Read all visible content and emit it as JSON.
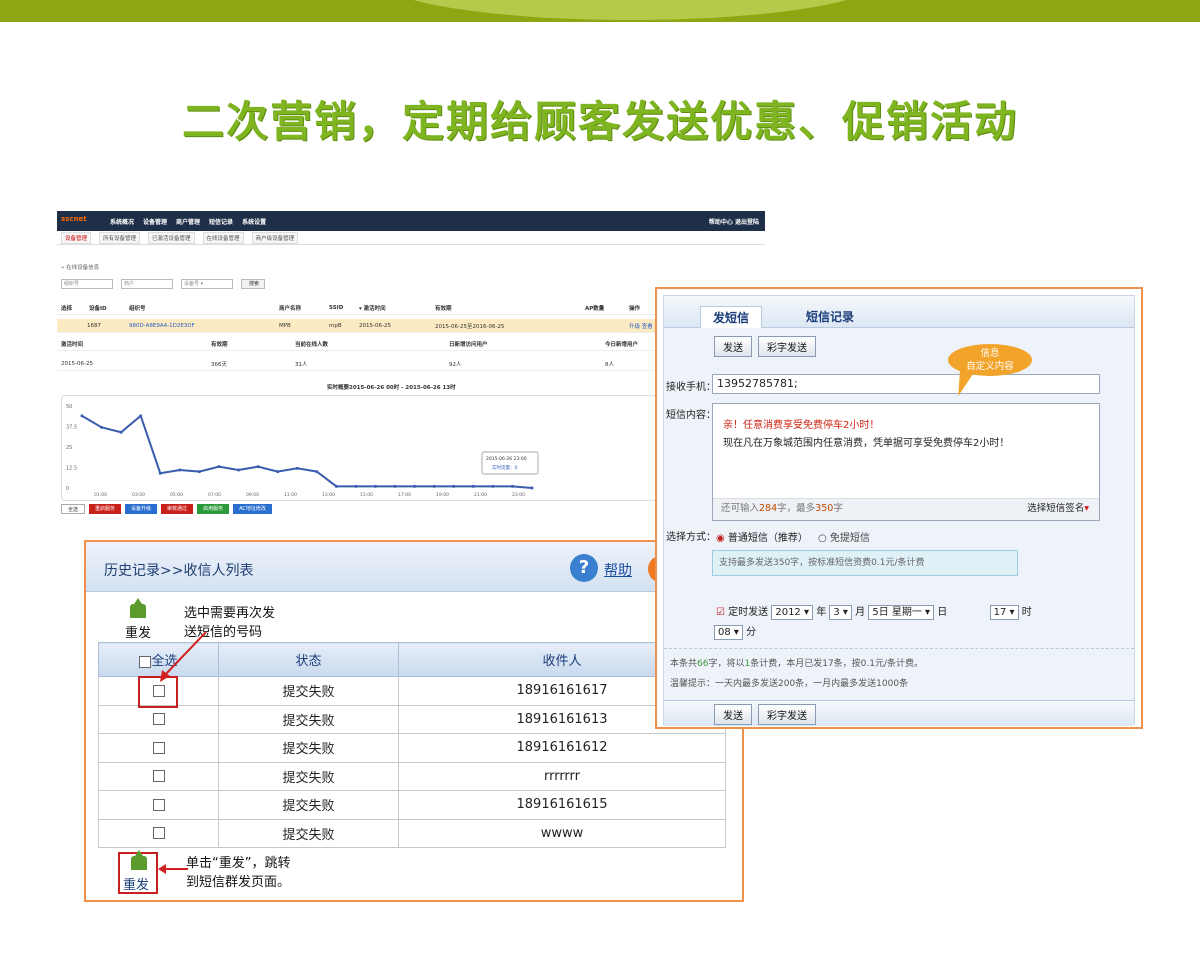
{
  "headline": "二次营销，定期给顾客发送优惠、促销活动",
  "admin": {
    "logo": "sscnet",
    "nav": [
      "系统概况",
      "设备管理",
      "商户管理",
      "短信记录",
      "系统设置"
    ],
    "nav_right": "帮助中心 退出登陆",
    "subnav": [
      "设备管理",
      "所有设备管理",
      "已激活设备管理",
      "在线设备管理",
      "商户级设备管理"
    ],
    "crumb": "» 在线设备信息",
    "filters": [
      "组织号",
      "商户",
      "设备号 ▾",
      "搜索"
    ],
    "header_row": [
      "选择",
      "设备ID",
      "组织号",
      "商户名称",
      "SSID",
      "▾ 激活时间",
      "有效期",
      "AP数量",
      "操作"
    ],
    "device_row": [
      "1687",
      "980D-A8E9A4-1D2E3DF",
      "MPB",
      "mpB",
      "2015-06-25",
      "2015-06-25至2016-06-25",
      "升级 查看"
    ],
    "stats_header": [
      "激活时间",
      "有效期",
      "当前在线人数",
      "日新增访问用户",
      "今日新增用户"
    ],
    "stats_row": [
      "2015-06-25",
      "366天",
      "31人",
      "92人",
      "8人"
    ],
    "chart_title": "实时概要2015-06-26 00时 - 2015-06-26 13时",
    "chart_y_ticks": [
      "50",
      "37.5",
      "25",
      "12.5",
      "0"
    ],
    "chart_x_ticks": [
      "01:00",
      "03:00",
      "05:00",
      "07:00",
      "09:00",
      "11:00",
      "13:00",
      "15:00",
      "17:00",
      "19:00",
      "21:00",
      "23:00"
    ],
    "tooltip": [
      "2015-06-26 23:00",
      "实时流量：0"
    ],
    "legend_buttons": [
      "全选",
      "重启服务",
      "设备升级",
      "审核通过",
      "启用服务",
      "AC地址修改"
    ]
  },
  "chart_data": {
    "type": "line",
    "title": "实时概要2015-06-26 00时 - 2015-06-26 13时",
    "x": [
      "00:00",
      "01:00",
      "02:00",
      "03:00",
      "04:00",
      "05:00",
      "06:00",
      "07:00",
      "08:00",
      "09:00",
      "10:00",
      "11:00",
      "12:00",
      "13:00",
      "14:00",
      "15:00",
      "16:00",
      "17:00",
      "18:00",
      "19:00",
      "20:00",
      "21:00",
      "22:00",
      "23:00"
    ],
    "values": [
      44,
      37,
      34,
      44,
      9,
      11,
      10,
      13,
      11,
      13,
      10,
      12,
      10,
      1,
      1,
      1,
      1,
      1,
      1,
      1,
      1,
      1,
      1,
      0
    ],
    "ylim": [
      0,
      50
    ],
    "yticks": [
      0,
      12.5,
      25,
      37.5,
      50
    ],
    "grid": false,
    "color": "#3a5cae"
  },
  "history": {
    "title": "历史记录>>收信人列表",
    "help": "帮助",
    "resend_label": "重发",
    "note_top": [
      "选中需要再次发",
      "送短信的号码"
    ],
    "columns": [
      "全选",
      "状态",
      "收件人"
    ],
    "rows": [
      {
        "status": "提交失败",
        "recipient": "18916161617"
      },
      {
        "status": "提交失败",
        "recipient": "18916161613"
      },
      {
        "status": "提交失败",
        "recipient": "18916161612"
      },
      {
        "status": "提交失败",
        "recipient": "rrrrrrr"
      },
      {
        "status": "提交失败",
        "recipient": "18916161615"
      },
      {
        "status": "提交失败",
        "recipient": "wwww"
      }
    ],
    "note_bottom": [
      "单击“重发”，跳转",
      "到短信群发页面。"
    ]
  },
  "sms": {
    "tab_send": "发短信",
    "tab_record": "短信记录",
    "btn_send": "发送",
    "btn_color_send": "彩字发送",
    "bubble": [
      "信息",
      "自定义内容"
    ],
    "phone_label": "接收手机：",
    "phone_value": "13952785781;",
    "content_label": "短信内容：",
    "content_line1": "亲！任意消费享受免费停车2小时！",
    "content_line2": "现在凡在万象城范围内任意消费，凭单据可享受免费停车2小时！",
    "remain_prefix": "还可输入",
    "remain_count": "284",
    "remain_mid": "字，最多",
    "remain_max": "350",
    "remain_suffix": "字",
    "signature": "选择短信签名",
    "method_label": "选择方式：",
    "method_normal": "普通短信（推荐）",
    "method_free": "免提短信",
    "info_text": "支持最多发送350字，按标准短信资费0.1元/条计费",
    "timed_label": "定时发送",
    "year": "2012",
    "year_unit": "年",
    "month": "3",
    "month_unit": "月",
    "day": "5日 星期一",
    "day_unit": "日",
    "hour": "17",
    "hour_unit": "时",
    "minute": "08",
    "minute_unit": "分",
    "stat_a": "本条共",
    "stat_count": "66",
    "stat_b": "字，将以",
    "stat_num": "1",
    "stat_c": "条计费，本月已发17条，按0.1元/条计费。",
    "tip": "温馨提示：一天内最多发送200条，一月内最多发送1000条"
  }
}
